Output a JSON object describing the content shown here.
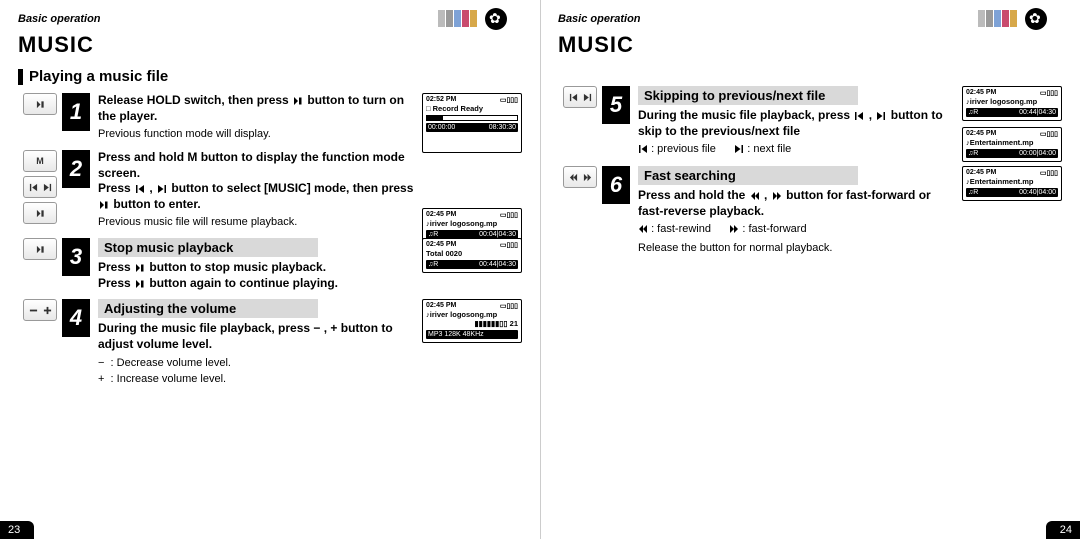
{
  "header": {
    "basic_op": "Basic operation",
    "music": "MUSIC"
  },
  "left": {
    "section_title": "Playing a music file",
    "step1": {
      "lead_a": "Release HOLD switch, then press ",
      "lead_b": " button to turn on the player.",
      "sub": "Previous function mode will display.",
      "screen": {
        "time": "02:52 PM",
        "t1": "Record Ready",
        "bar_l": "00:00:00",
        "bar_r": "08:30:30"
      }
    },
    "step2": {
      "lead_a": "Press and hold ",
      "lead_b": " button to  display the function mode screen.",
      "lead2_a": "Press ",
      "lead2_b": " button to select [MUSIC] mode, then press ",
      "lead2_c": " button to enter.",
      "sub": "Previous music file will resume playback.",
      "screen": {
        "time": "02:45 PM",
        "t1": "♪iriver logosong.mp",
        "bar_l": "♫R",
        "bar_r": "00:04|04:30"
      }
    },
    "step3": {
      "title": "Stop music playback",
      "l1_a": "Press ",
      "l1_b": " button to stop music playback.",
      "l2_a": "Press ",
      "l2_b": " button again to continue playing.",
      "screen": {
        "time": "02:45 PM",
        "t1": "Total 0020",
        "bar_l": "♫R",
        "bar_r": "00:44|04:30"
      }
    },
    "step4": {
      "title": "Adjusting the volume",
      "l1": "During the music file playback, press  − ,  +  button to adjust volume level.",
      "leg_minus": ": Decrease volume level.",
      "leg_plus": ": Increase volume level.",
      "screen": {
        "time": "02:45 PM",
        "t1": "♪iriver logosong.mp",
        "vol": "▮▮▮▮▮▮▯▯ 21",
        "bar": "MP3  128K  48KHz"
      }
    },
    "page": "23"
  },
  "right": {
    "step5": {
      "title": "Skipping to previous/next file",
      "l1_a": "During the music file playback, press ",
      "l1_b": " button to skip to the previous/next file",
      "leg_prev": ": previous file",
      "leg_next": ": next file",
      "screenA": {
        "time": "02:45 PM",
        "t1": "♪iriver logosong.mp",
        "bar_l": "♫R",
        "bar_r": "00:44|04:30"
      },
      "screenB": {
        "time": "02:45 PM",
        "t1": "♪Entertainment.mp",
        "bar_l": "♫R",
        "bar_r": "00:00|04:00"
      }
    },
    "step6": {
      "title": "Fast searching",
      "l1_a": "Press and hold the ",
      "l1_b": " button for fast-forward or fast-reverse playback.",
      "leg_rew": ": fast-rewind",
      "leg_ff": ": fast-forward",
      "sub": "Release the button for normal playback.",
      "screen": {
        "time": "02:45 PM",
        "t1": "♪Entertainment.mp",
        "bar_l": "♫R",
        "bar_r": "00:40|04:00"
      }
    },
    "page": "24"
  }
}
